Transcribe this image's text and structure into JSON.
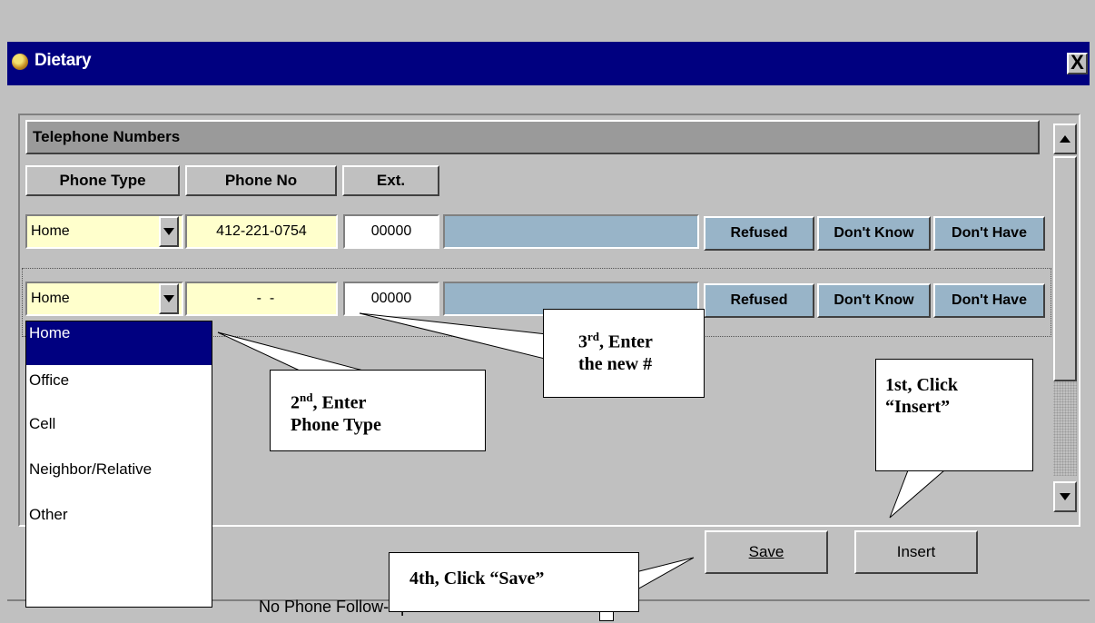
{
  "window": {
    "title": "Dietary",
    "close_label": "X"
  },
  "section": {
    "title": "Telephone Numbers"
  },
  "columns": {
    "phone_type": "Phone Type",
    "phone_no": "Phone No",
    "ext": "Ext."
  },
  "rows": [
    {
      "phone_type": "Home",
      "phone_no": "412-221-0754",
      "ext": "00000",
      "refused": "Refused",
      "dont_know": "Don't Know",
      "dont_have": "Don't Have"
    },
    {
      "phone_type": "Home",
      "phone_no": "  -  -",
      "ext": "00000",
      "refused": "Refused",
      "dont_know": "Don't Know",
      "dont_have": "Don't Have"
    }
  ],
  "dropdown": {
    "options": [
      "Home",
      "Office",
      "Cell",
      "Neighbor/Relative",
      "Other"
    ],
    "selected": "Home"
  },
  "buttons": {
    "save": "Save",
    "insert": "Insert"
  },
  "footer": {
    "no_phone_label": "No Phone Follow-Up Interview"
  },
  "callouts": {
    "first": "1st, Click “Insert”",
    "second_num": "2",
    "second_sup": "nd",
    "second_rest": ", Enter",
    "second_line2": "Phone Type",
    "third_num": "3",
    "third_sup": "rd",
    "third_rest": ", Enter",
    "third_line2": "the new #",
    "fourth": "4th, Click “Save”"
  },
  "colors": {
    "titlebar": "#000080",
    "field_yellow": "#ffffcc",
    "button_blue": "#98b4c8",
    "dialog": "#c0c0c0"
  }
}
